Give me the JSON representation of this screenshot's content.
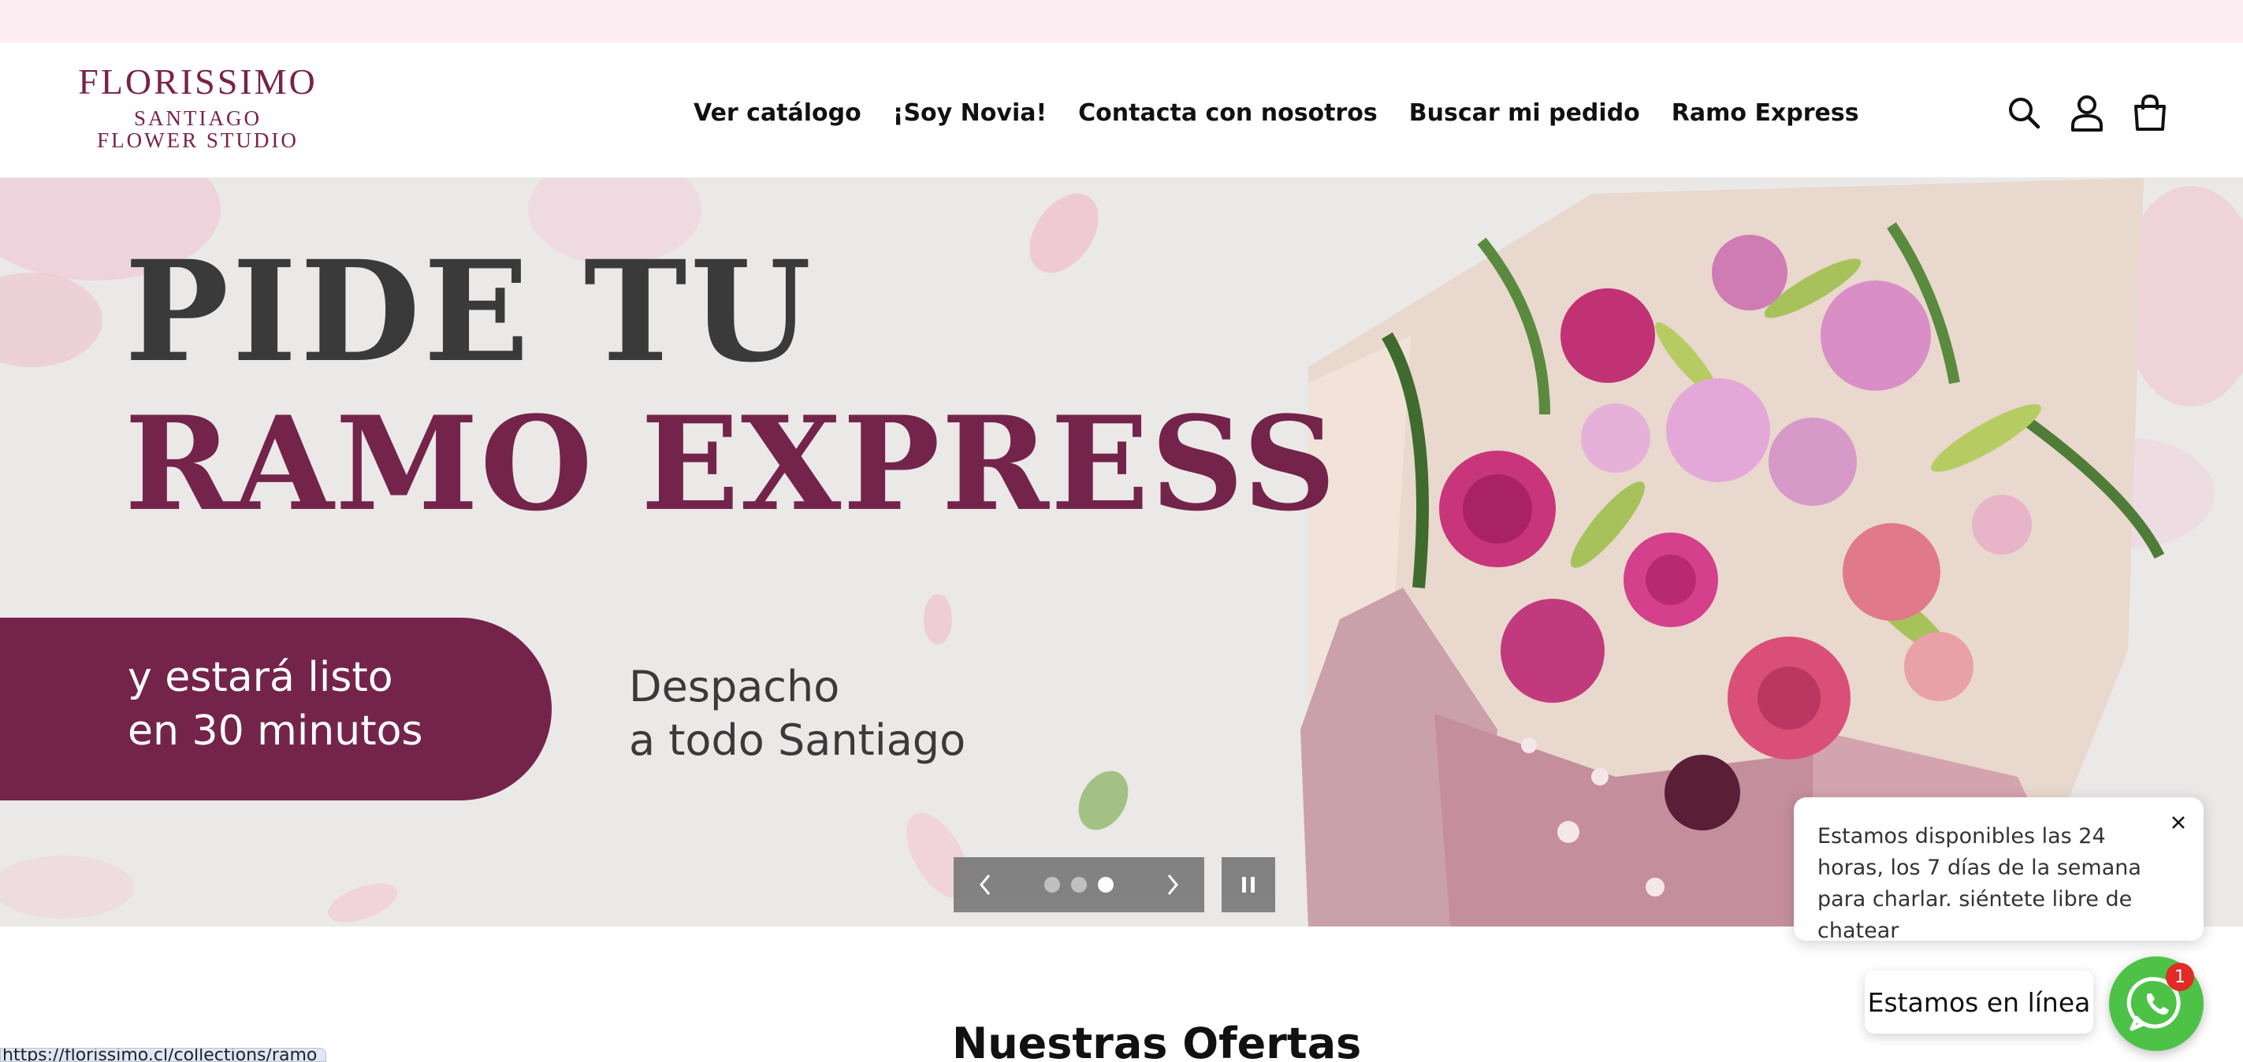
{
  "announcement_bar": {
    "color": "#fcedf3"
  },
  "logo": {
    "line1": "FLORISSIMO",
    "line2": "SANTIAGO",
    "line3": "FLOWER STUDIO",
    "color": "#7a2248"
  },
  "nav": {
    "items": [
      {
        "label": "Ver catálogo"
      },
      {
        "label": "¡Soy Novia!"
      },
      {
        "label": "Contacta con nosotros"
      },
      {
        "label": "Buscar mi pedido"
      },
      {
        "label": "Ramo Express"
      }
    ]
  },
  "header_icons": [
    "search-icon",
    "account-icon",
    "cart-icon"
  ],
  "hero": {
    "title_line1": "PIDE TU",
    "title_line2": "RAMO EXPRESS",
    "pill_text_line1": "y estará listo",
    "pill_text_line2": "en 30 minutos",
    "delivery_line1": "Despacho",
    "delivery_line2": "a todo Santiago",
    "accent_color": "#74244a",
    "slider": {
      "total_slides": 3,
      "active_slide": 3
    }
  },
  "section": {
    "title": "Nuestras Ofertas"
  },
  "chat": {
    "bubble_text": "Estamos disponibles las 24 horas, los 7 días de la semana para charlar. siéntete libre de chatear",
    "online_label": "Estamos en línea",
    "badge_count": "1",
    "whatsapp_color": "#4dc247"
  },
  "status_bar": {
    "url": "https://florissimo.cl/collections/ramo"
  }
}
